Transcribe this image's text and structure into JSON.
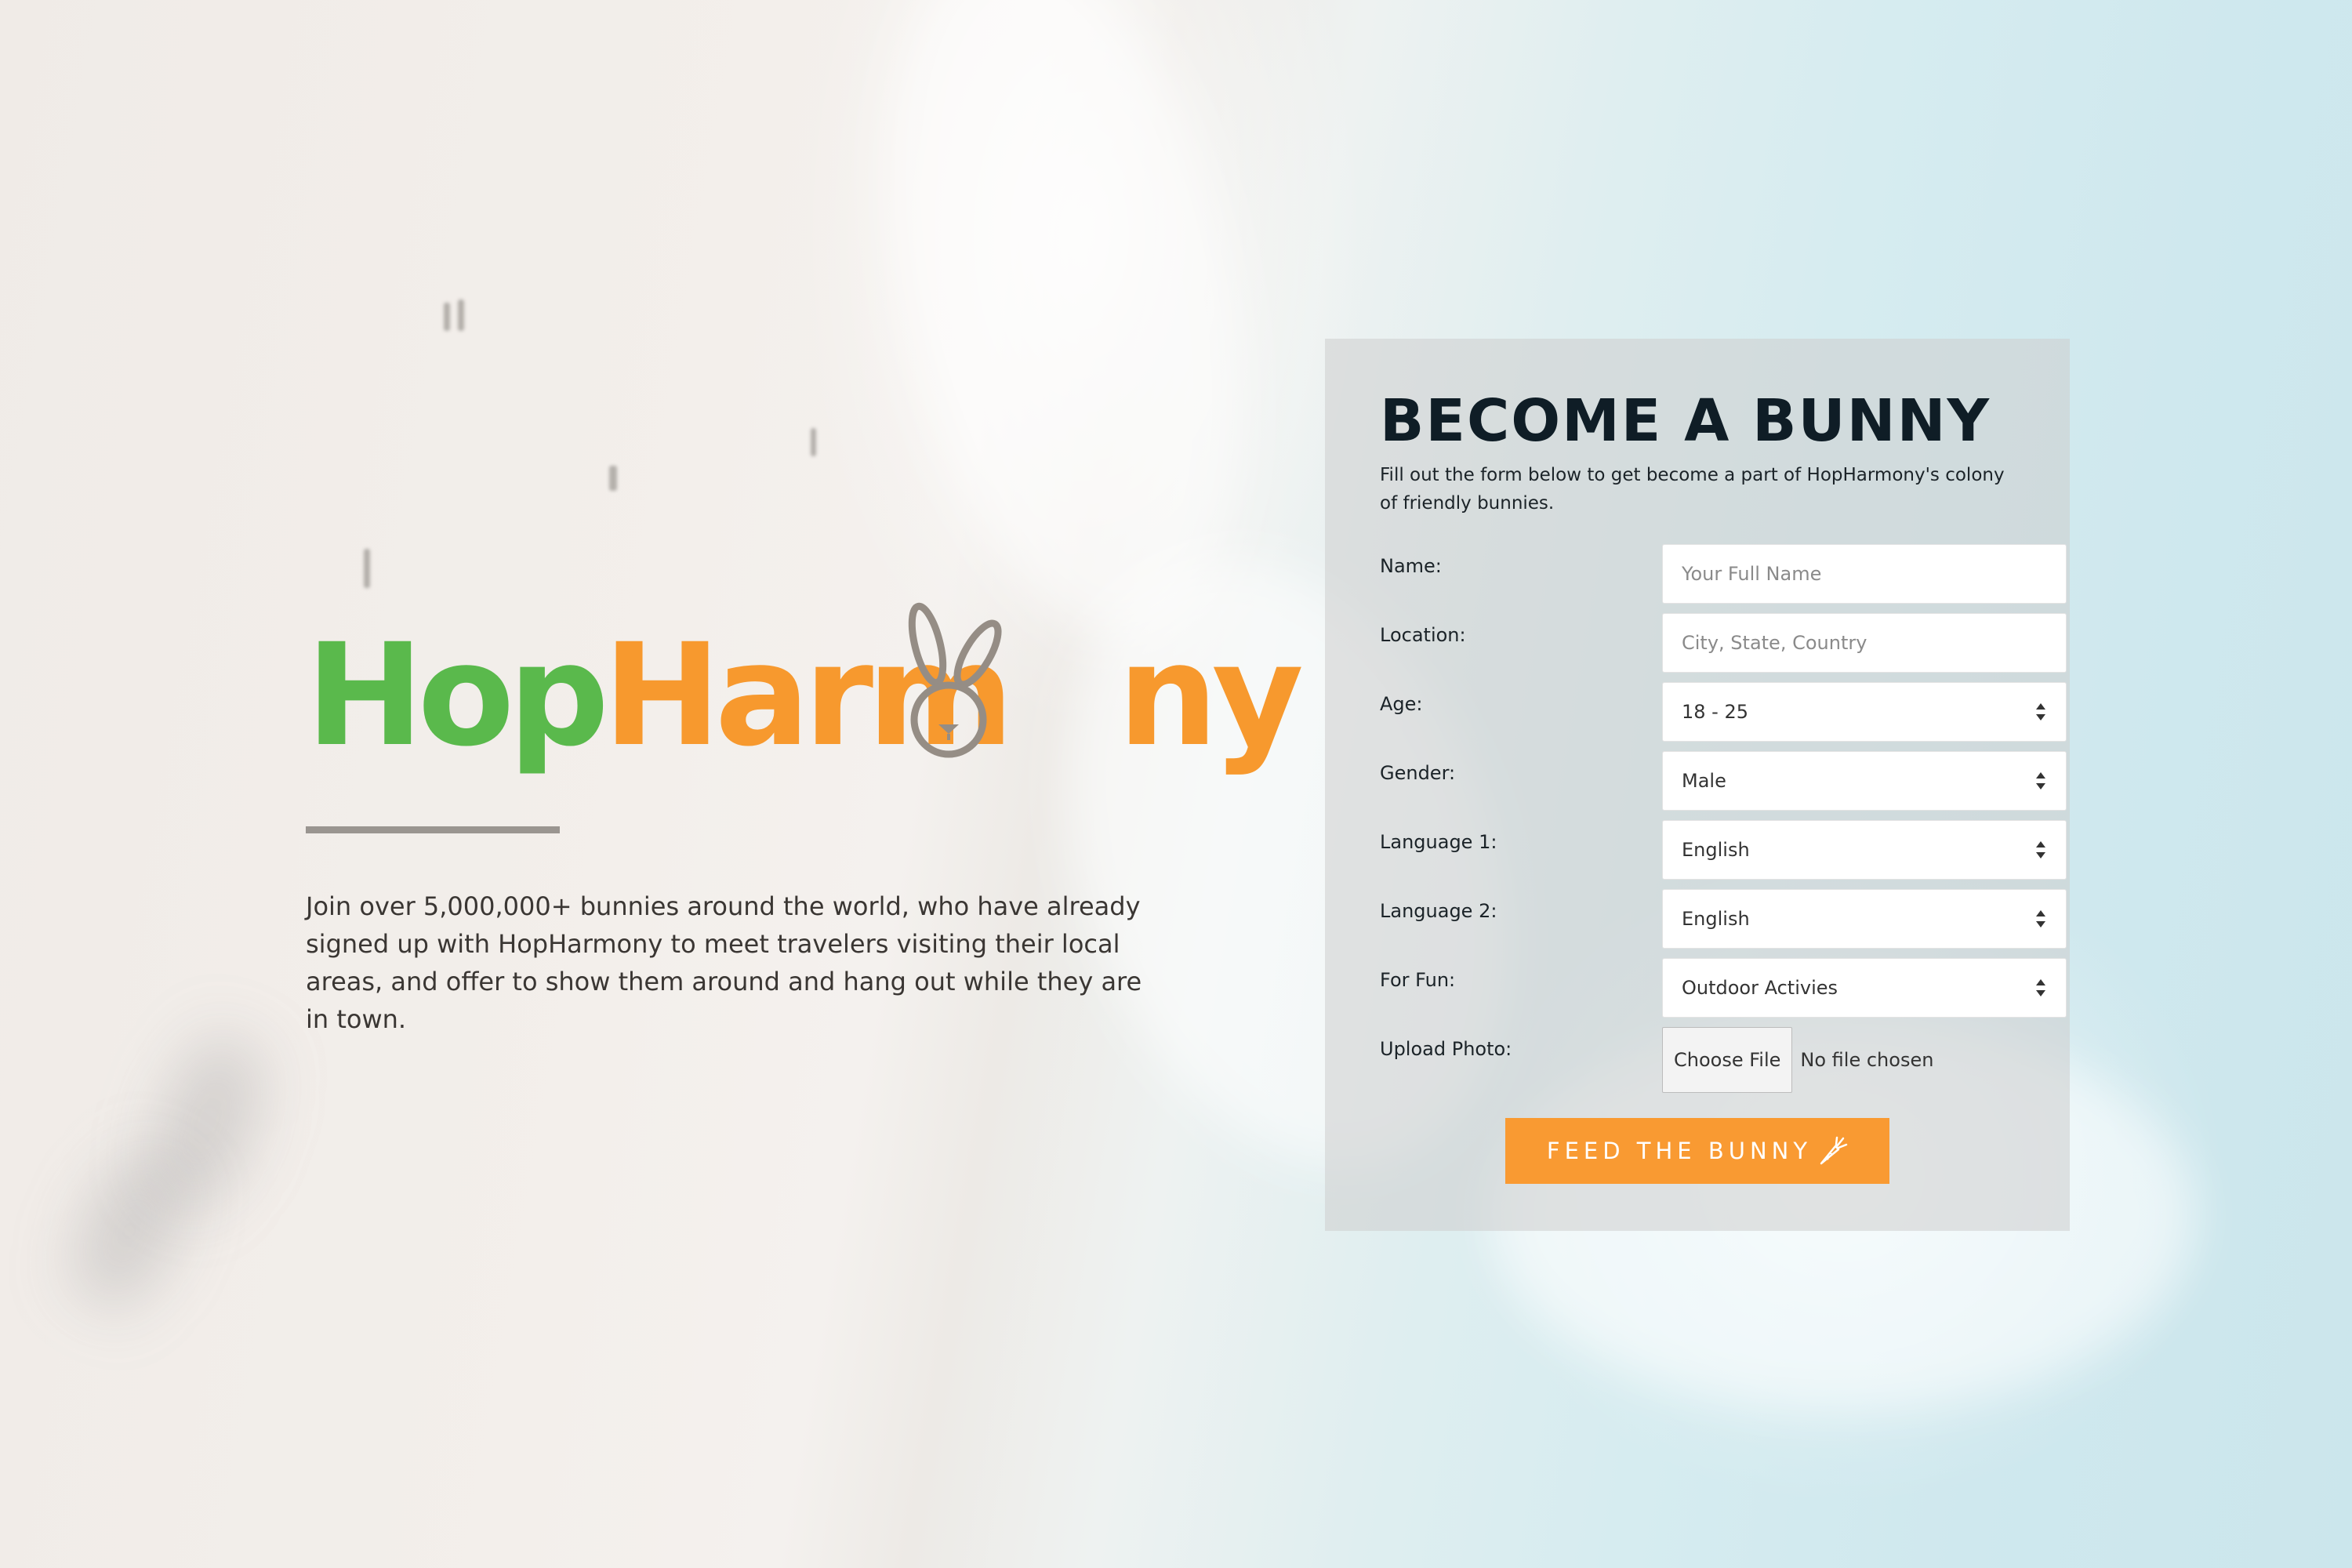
{
  "brand": {
    "name_part1": "Hop",
    "name_part2": "Harm",
    "name_part3": "ny",
    "colors": {
      "green": "#5ab94c",
      "orange": "#f7992e",
      "gray": "#958d85"
    }
  },
  "intro": {
    "text": "Join over 5,000,000+ bunnies around the world, who have already signed up with HopHarmony to meet travelers visiting their local areas, and offer to show them around and hang out while they are in town."
  },
  "form": {
    "title": "BECOME A BUNNY",
    "subtitle": "Fill out the form below to get become a part of HopHarmony's colony of friendly bunnies.",
    "name": {
      "label": "Name:",
      "placeholder": "Your Full Name"
    },
    "location": {
      "label": "Location:",
      "placeholder": "City, State, Country"
    },
    "age": {
      "label": "Age:",
      "value": "18 - 25"
    },
    "gender": {
      "label": "Gender:",
      "value": "Male"
    },
    "language1": {
      "label": "Language 1:",
      "value": "English"
    },
    "language2": {
      "label": "Language 2:",
      "value": "English"
    },
    "for_fun": {
      "label": "For Fun:",
      "value": "Outdoor Activies"
    },
    "upload": {
      "label": "Upload Photo:",
      "button": "Choose File",
      "status": "No file chosen"
    },
    "submit": {
      "label": "FEED THE BUNNY",
      "icon": "carrot-icon",
      "color": "#f99a32"
    }
  }
}
